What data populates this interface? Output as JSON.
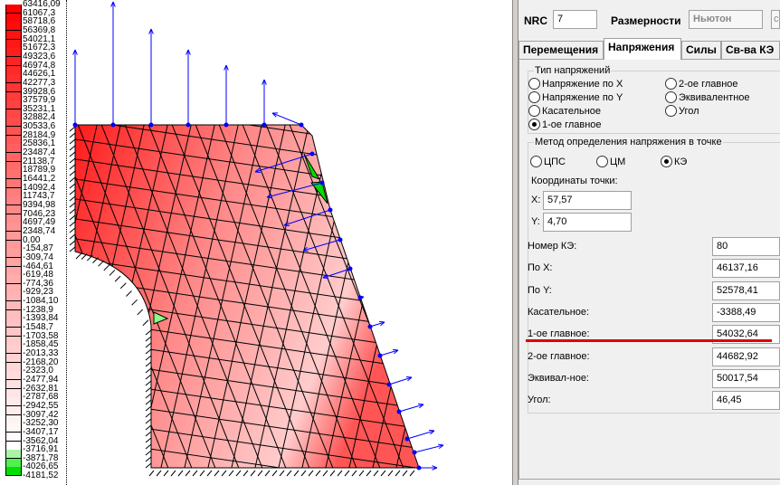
{
  "legend": {
    "values": [
      "63416,09",
      "61067,3",
      "58718,6",
      "56369,8",
      "54021,1",
      "51672,3",
      "49323,6",
      "46974,8",
      "44626,1",
      "42277,3",
      "39928,6",
      "37579,9",
      "35231,1",
      "32882,4",
      "30533,6",
      "28184,9",
      "25836,1",
      "23487,4",
      "21138,7",
      "18789,9",
      "16441,2",
      "14092,4",
      "11743,7",
      "9394,98",
      "7046,23",
      "4697,49",
      "2348,74",
      "0,00",
      "-154,87",
      "-309,74",
      "-464,61",
      "-619,48",
      "-774,36",
      "-929,23",
      "-1084,10",
      "-1238,9",
      "-1393,84",
      "-1548,7",
      "-1703,58",
      "-1858,45",
      "-2013,33",
      "-2168,20",
      "-2323,0",
      "-2477,94",
      "-2632,81",
      "-2787,68",
      "-2942,55",
      "-3097,42",
      "-3252,30",
      "-3407,17",
      "-3562,04",
      "-3716,91",
      "-3871,78",
      "-4026,65",
      "-4181,52"
    ],
    "max_color": "#ff0000",
    "zero_color": "#ff9a9a",
    "neg_color": "#ffffff",
    "green_colors": [
      "#a8f5a8",
      "#50f050",
      "#00e000"
    ]
  },
  "header": {
    "nrc_label": "NRC",
    "nrc_value": "7",
    "dim_label": "Размерности",
    "dim_value": "Ньютон",
    "dim_value2": "с"
  },
  "tabs": [
    {
      "label": "Перемещения"
    },
    {
      "label": "Напряжения"
    },
    {
      "label": "Силы"
    },
    {
      "label": "Св-ва КЭ"
    }
  ],
  "stress_type": {
    "title": "Тип напряжений",
    "options": [
      "Напряжение по X",
      "Напряжение по Y",
      "Касательное",
      "1-ое главное",
      "2-ое главное",
      "Эквивалентное",
      "Угол"
    ],
    "selected": "1-ое главное"
  },
  "method": {
    "title": "Метод определения напряжения в точке",
    "options": [
      "ЦПС",
      "ЦМ",
      "КЭ"
    ],
    "selected": "КЭ"
  },
  "coords": {
    "title": "Координаты точки:",
    "x_label": "X:",
    "x_value": "57,57",
    "y_label": "Y:",
    "y_value": "4,70"
  },
  "results": [
    {
      "label": "Номер КЭ:",
      "value": "80"
    },
    {
      "label": "По X:",
      "value": "46137,16"
    },
    {
      "label": "По Y:",
      "value": "52578,41"
    },
    {
      "label": "Касательное:",
      "value": "-3388,49"
    },
    {
      "label": "1-ое главное:",
      "value": "54032,64"
    },
    {
      "label": "2-ое главное:",
      "value": "44682,92"
    },
    {
      "label": "Эквивал-ное:",
      "value": "50017,54"
    },
    {
      "label": "Угол:",
      "value": "46,45"
    }
  ],
  "colors": {
    "mesh_line": "#000000",
    "node": "#0000ff",
    "arrow": "#0000ff",
    "highlight": "#ff0000",
    "tension_green": "#00dd00"
  }
}
